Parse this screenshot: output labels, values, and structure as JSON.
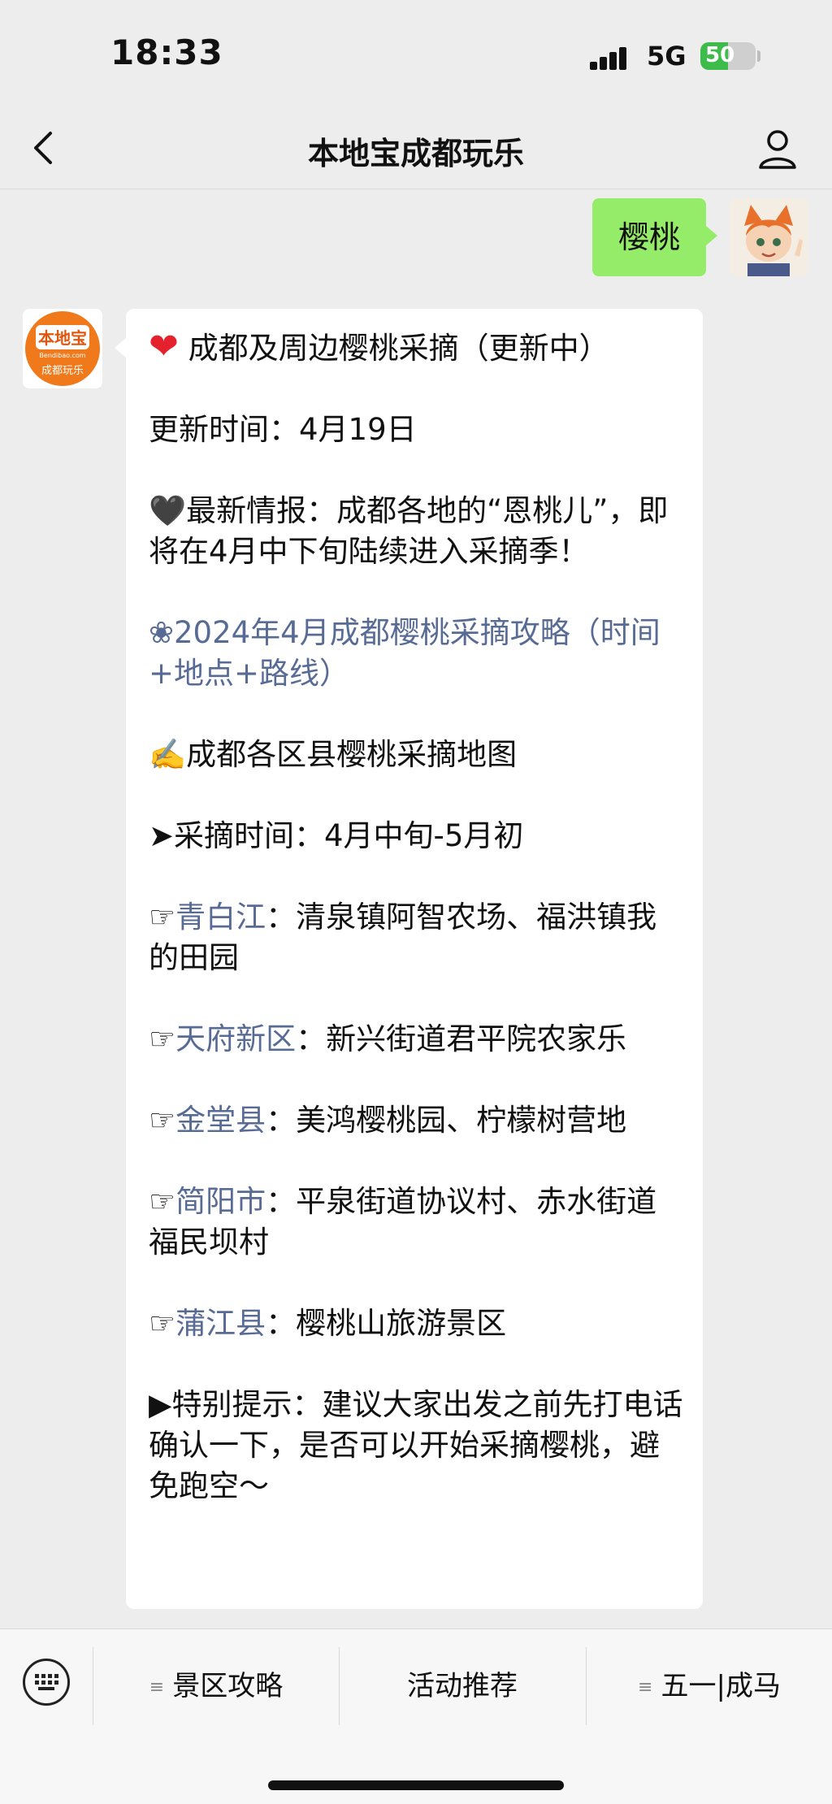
{
  "status_bar": {
    "time": "18:33",
    "network": "5G",
    "battery": "50",
    "battery_level": 0.5,
    "battery_color": "#3dbb4b"
  },
  "nav": {
    "back_icon": "chevron-left-icon",
    "title": "本地宝成都玩乐",
    "profile_icon": "person-icon"
  },
  "chat": {
    "user_message": "樱桃",
    "bot_avatar": {
      "logo_text": "本地宝",
      "domain_text": "Bendibao.com",
      "city_text": "成都玩乐",
      "brand_color": "#f07a1b"
    },
    "bot_message": {
      "title": "成都及周边樱桃采摘（更新中）",
      "updated": "更新时间：4月19日",
      "news": "🖤最新情报：成都各地的“恩桃儿”，即将在4月中下旬陆续进入采摘季！",
      "guide_prefix": "❀",
      "guide_link": "2024年4月成都樱桃采摘攻略（时间+地点+路线）",
      "map_title": "✍️成都各区县樱桃采摘地图",
      "pick_time": "➤采摘时间：4月中旬-5月初",
      "places": [
        {
          "prefix": "☞",
          "name": "青白江",
          "detail": "：清泉镇阿智农场、福洪镇我的田园"
        },
        {
          "prefix": "☞",
          "name": "天府新区",
          "detail": "：新兴街道君平院农家乐"
        },
        {
          "prefix": "☞",
          "name": "金堂县",
          "detail": "：美鸿樱桃园、柠檬树营地"
        },
        {
          "prefix": "☞",
          "name": "简阳市",
          "detail": "：平泉街道协议村、赤水街道福民坝村"
        },
        {
          "prefix": "☞",
          "name": "蒲江县",
          "detail": "：樱桃山旅游景区"
        }
      ],
      "tip": "▶特别提示：建议大家出发之前先打电话确认一下，是否可以开始采摘樱桃，避免跑空～"
    }
  },
  "bottom_bar": {
    "keyboard_icon": "keyboard-icon",
    "menu": [
      {
        "label": "景区攻略",
        "has_submenu": true
      },
      {
        "label": "活动推荐",
        "has_submenu": false
      },
      {
        "label": "五一|成马",
        "has_submenu": true
      }
    ]
  }
}
